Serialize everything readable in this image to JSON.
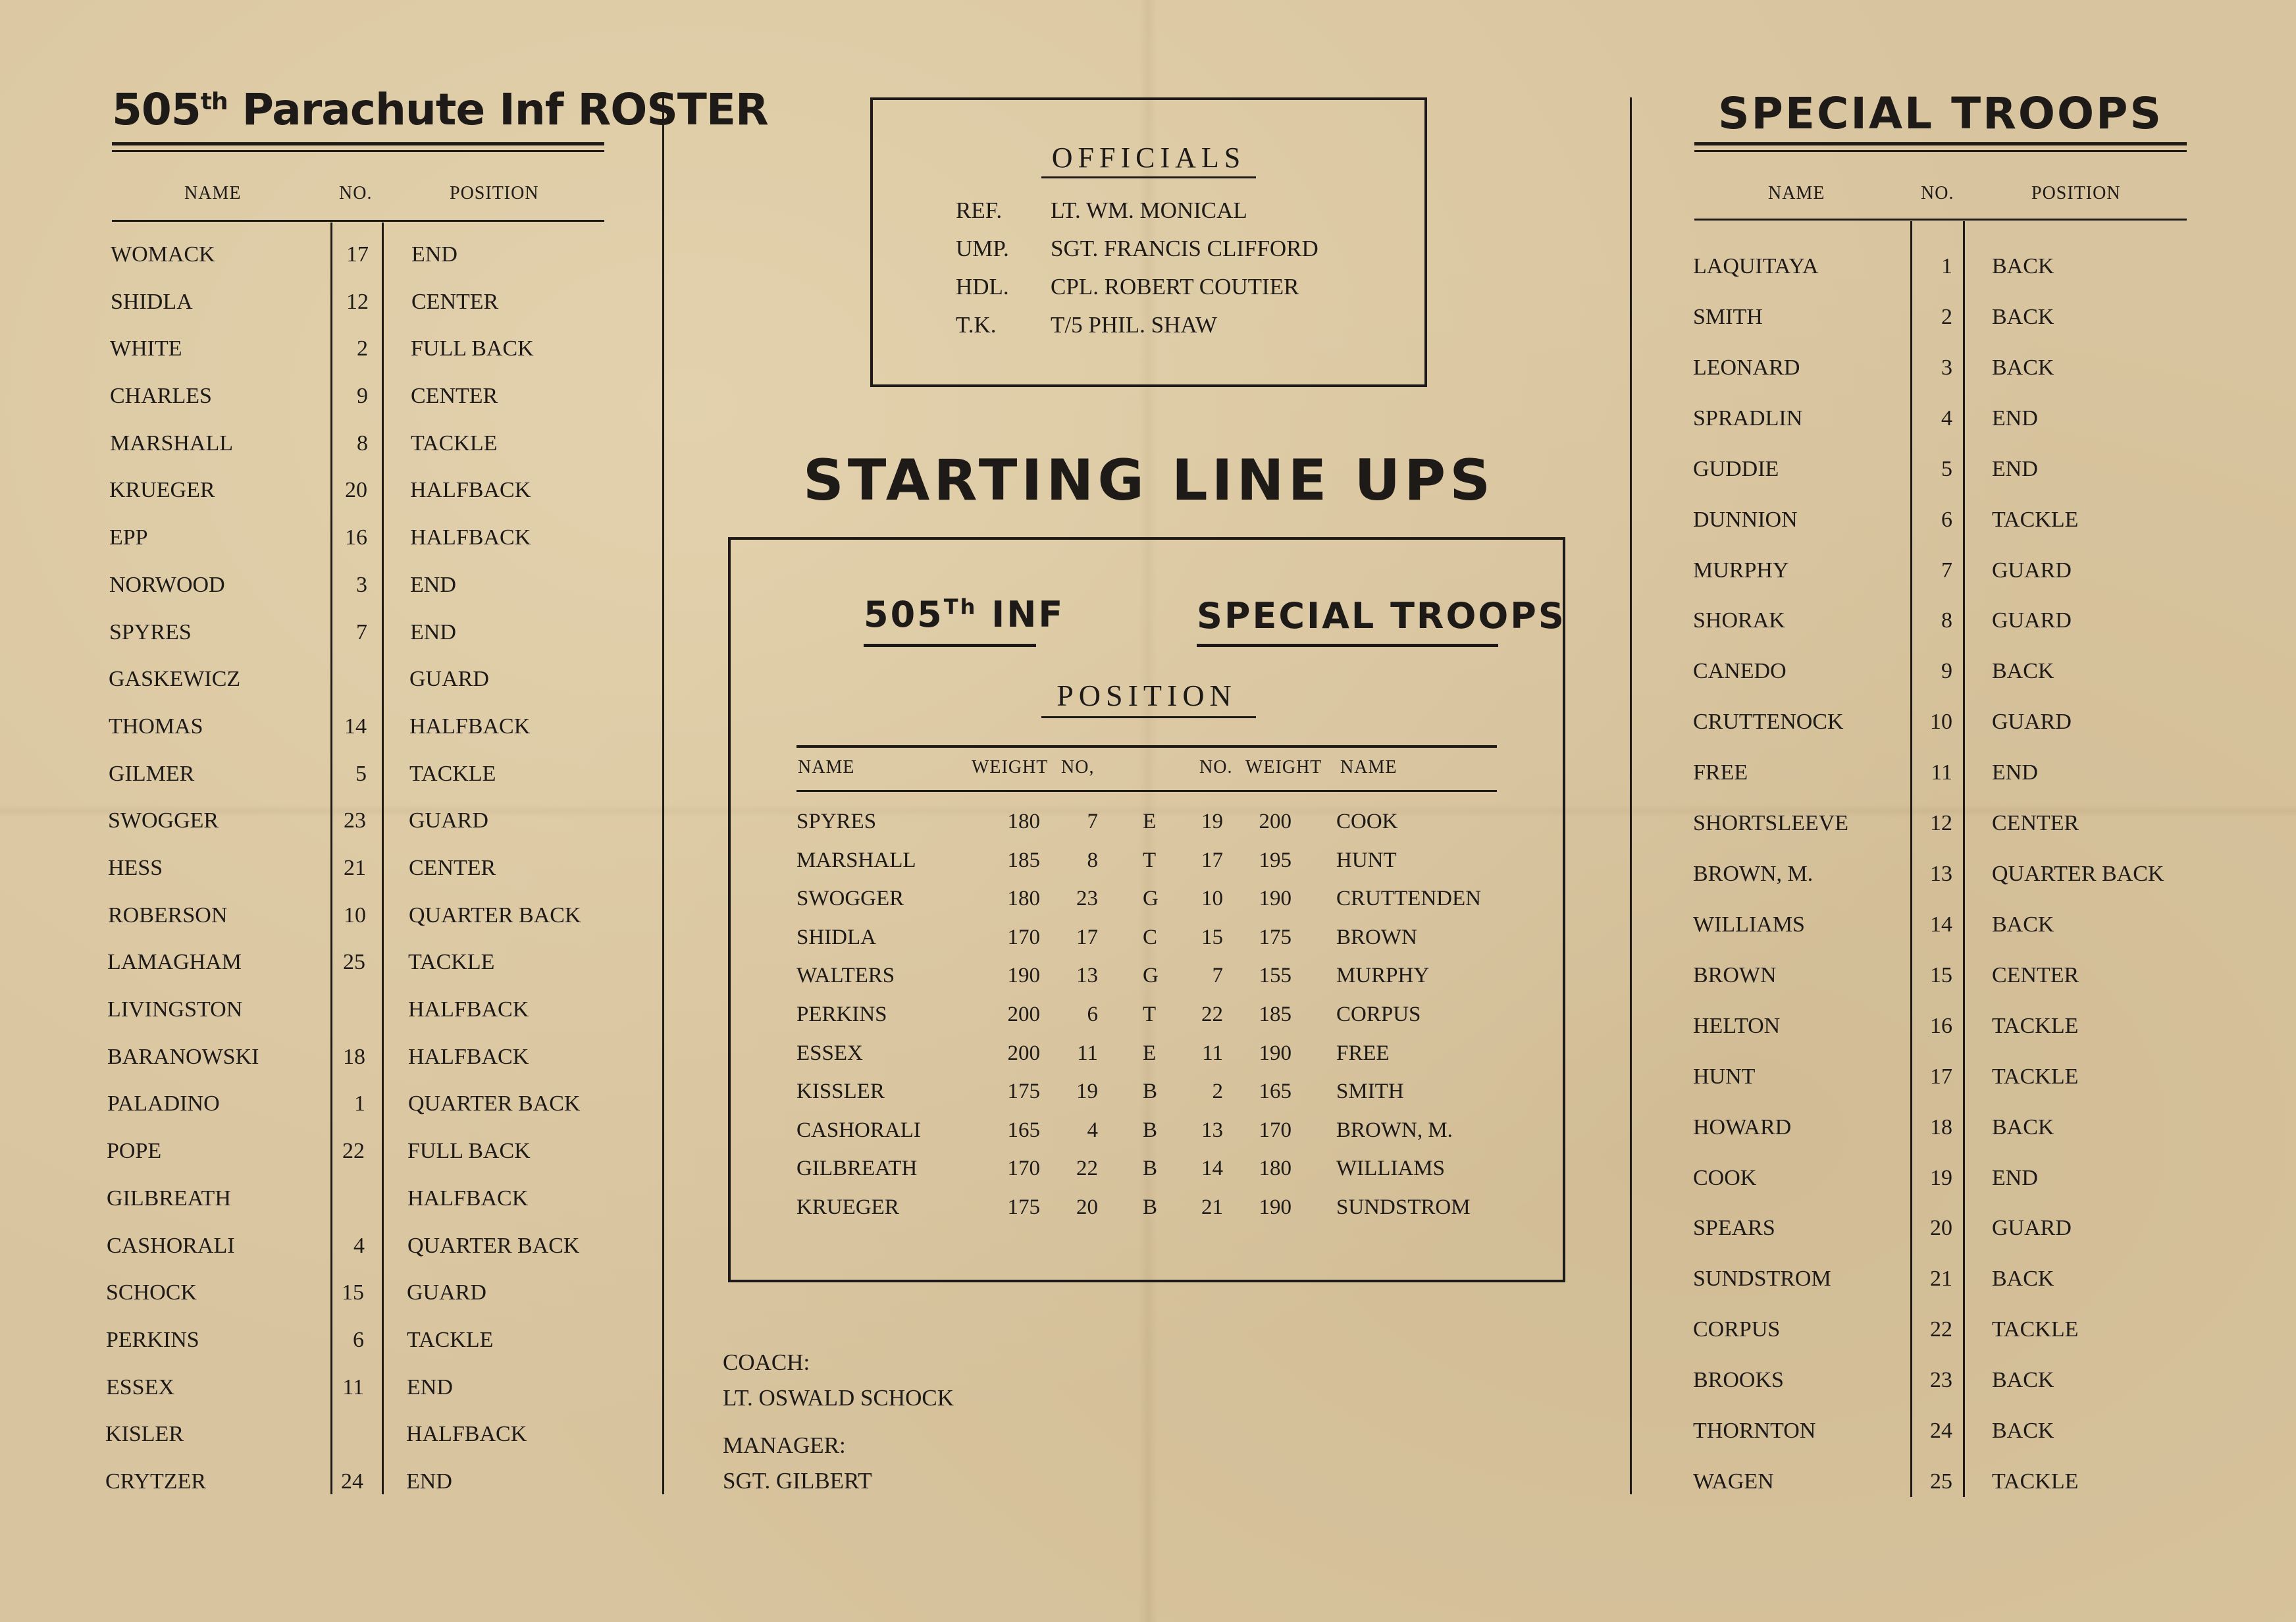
{
  "left_roster": {
    "title_pre": "505",
    "title_sup": "th",
    "title_post": " Parachute Inf ROSTER",
    "headers": [
      "NAME",
      "NO.",
      "POSITION"
    ],
    "rows": [
      {
        "name": "WOMACK",
        "no": "17",
        "pos": "END"
      },
      {
        "name": "SHIDLA",
        "no": "12",
        "pos": "CENTER"
      },
      {
        "name": "WHITE",
        "no": "2",
        "pos": "FULL BACK"
      },
      {
        "name": "CHARLES",
        "no": "9",
        "pos": "CENTER"
      },
      {
        "name": "MARSHALL",
        "no": "8",
        "pos": "TACKLE"
      },
      {
        "name": "KRUEGER",
        "no": "20",
        "pos": "HALFBACK"
      },
      {
        "name": "EPP",
        "no": "16",
        "pos": "HALFBACK"
      },
      {
        "name": "NORWOOD",
        "no": "3",
        "pos": "END"
      },
      {
        "name": "SPYRES",
        "no": "7",
        "pos": "END"
      },
      {
        "name": "GASKEWICZ",
        "no": "",
        "pos": "GUARD"
      },
      {
        "name": "THOMAS",
        "no": "14",
        "pos": "HALFBACK"
      },
      {
        "name": "GILMER",
        "no": "5",
        "pos": "TACKLE"
      },
      {
        "name": "SWOGGER",
        "no": "23",
        "pos": "GUARD"
      },
      {
        "name": "HESS",
        "no": "21",
        "pos": "CENTER"
      },
      {
        "name": "ROBERSON",
        "no": "10",
        "pos": "QUARTER BACK"
      },
      {
        "name": "LAMAGHAM",
        "no": "25",
        "pos": "TACKLE"
      },
      {
        "name": "LIVINGSTON",
        "no": "",
        "pos": "HALFBACK"
      },
      {
        "name": "BARANOWSKI",
        "no": "18",
        "pos": "HALFBACK"
      },
      {
        "name": "PALADINO",
        "no": "1",
        "pos": "QUARTER BACK"
      },
      {
        "name": "POPE",
        "no": "22",
        "pos": "FULL BACK"
      },
      {
        "name": "GILBREATH",
        "no": "",
        "pos": "HALFBACK"
      },
      {
        "name": "CASHORALI",
        "no": "4",
        "pos": "QUARTER BACK"
      },
      {
        "name": "SCHOCK",
        "no": "15",
        "pos": "GUARD"
      },
      {
        "name": "PERKINS",
        "no": "6",
        "pos": "TACKLE"
      },
      {
        "name": "ESSEX",
        "no": "11",
        "pos": "END"
      },
      {
        "name": "KISLER",
        "no": "",
        "pos": "HALFBACK"
      },
      {
        "name": "CRYTZER",
        "no": "24",
        "pos": "END"
      }
    ]
  },
  "officials": {
    "title": "OFFICIALS",
    "rows": [
      {
        "role": "REF.",
        "name": "LT. WM. MONICAL"
      },
      {
        "role": "UMP.",
        "name": "SGT. FRANCIS CLIFFORD"
      },
      {
        "role": "HDL.",
        "name": "CPL. ROBERT COUTIER"
      },
      {
        "role": "T.K.",
        "name": "T/5 PHIL. SHAW"
      }
    ]
  },
  "lineups": {
    "title": "STARTING LINE UPS",
    "team_left_pre": "505",
    "team_left_sup": "Th",
    "team_left_post": " INF",
    "team_right": "SPECIAL TROOPS",
    "position_title": "POSITION",
    "headers": {
      "name_l": "NAME",
      "weight_l": "WEIGHT",
      "no_l": "NO,",
      "no_r": "NO.",
      "weight_r": "WEIGHT",
      "name_r": "NAME"
    },
    "rows": [
      {
        "ln": "SPYRES",
        "lw": "180",
        "lno": "7",
        "pos": "E",
        "rno": "19",
        "rw": "200",
        "rn": "COOK"
      },
      {
        "ln": "MARSHALL",
        "lw": "185",
        "lno": "8",
        "pos": "T",
        "rno": "17",
        "rw": "195",
        "rn": "HUNT"
      },
      {
        "ln": "SWOGGER",
        "lw": "180",
        "lno": "23",
        "pos": "G",
        "rno": "10",
        "rw": "190",
        "rn": "CRUTTENDEN"
      },
      {
        "ln": "SHIDLA",
        "lw": "170",
        "lno": "17",
        "pos": "C",
        "rno": "15",
        "rw": "175",
        "rn": "BROWN"
      },
      {
        "ln": "WALTERS",
        "lw": "190",
        "lno": "13",
        "pos": "G",
        "rno": "7",
        "rw": "155",
        "rn": "MURPHY"
      },
      {
        "ln": "PERKINS",
        "lw": "200",
        "lno": "6",
        "pos": "T",
        "rno": "22",
        "rw": "185",
        "rn": "CORPUS"
      },
      {
        "ln": "ESSEX",
        "lw": "200",
        "lno": "11",
        "pos": "E",
        "rno": "11",
        "rw": "190",
        "rn": "FREE"
      },
      {
        "ln": "KISSLER",
        "lw": "175",
        "lno": "19",
        "pos": "B",
        "rno": "2",
        "rw": "165",
        "rn": "SMITH"
      },
      {
        "ln": "CASHORALI",
        "lw": "165",
        "lno": "4",
        "pos": "B",
        "rno": "13",
        "rw": "170",
        "rn": "BROWN, M."
      },
      {
        "ln": "GILBREATH",
        "lw": "170",
        "lno": "22",
        "pos": "B",
        "rno": "14",
        "rw": "180",
        "rn": "WILLIAMS"
      },
      {
        "ln": "KRUEGER",
        "lw": "175",
        "lno": "20",
        "pos": "B",
        "rno": "21",
        "rw": "190",
        "rn": "SUNDSTROM"
      }
    ]
  },
  "staff": {
    "coach_label": "COACH:",
    "coach_name": "LT. OSWALD SCHOCK",
    "manager_label": "MANAGER:",
    "manager_name": "SGT. GILBERT"
  },
  "right_roster": {
    "title": "SPECIAL TROOPS",
    "headers": [
      "NAME",
      "NO.",
      "POSITION"
    ],
    "rows": [
      {
        "name": "LAQUITAYA",
        "no": "1",
        "pos": "BACK"
      },
      {
        "name": "SMITH",
        "no": "2",
        "pos": "BACK"
      },
      {
        "name": "LEONARD",
        "no": "3",
        "pos": "BACK"
      },
      {
        "name": "SPRADLIN",
        "no": "4",
        "pos": "END"
      },
      {
        "name": "GUDDIE",
        "no": "5",
        "pos": "END"
      },
      {
        "name": "DUNNION",
        "no": "6",
        "pos": "TACKLE"
      },
      {
        "name": "MURPHY",
        "no": "7",
        "pos": "GUARD"
      },
      {
        "name": "SHORAK",
        "no": "8",
        "pos": "GUARD"
      },
      {
        "name": "CANEDO",
        "no": "9",
        "pos": "BACK"
      },
      {
        "name": "CRUTTENOCK",
        "no": "10",
        "pos": "GUARD"
      },
      {
        "name": "FREE",
        "no": "11",
        "pos": "END"
      },
      {
        "name": "SHORTSLEEVE",
        "no": "12",
        "pos": "CENTER"
      },
      {
        "name": "BROWN, M.",
        "no": "13",
        "pos": "QUARTER BACK"
      },
      {
        "name": "WILLIAMS",
        "no": "14",
        "pos": "BACK"
      },
      {
        "name": "BROWN",
        "no": "15",
        "pos": "CENTER"
      },
      {
        "name": "HELTON",
        "no": "16",
        "pos": "TACKLE"
      },
      {
        "name": "HUNT",
        "no": "17",
        "pos": "TACKLE"
      },
      {
        "name": "HOWARD",
        "no": "18",
        "pos": "BACK"
      },
      {
        "name": "COOK",
        "no": "19",
        "pos": "END"
      },
      {
        "name": "SPEARS",
        "no": "20",
        "pos": "GUARD"
      },
      {
        "name": "SUNDSTROM",
        "no": "21",
        "pos": "BACK"
      },
      {
        "name": "CORPUS",
        "no": "22",
        "pos": "TACKLE"
      },
      {
        "name": "BROOKS",
        "no": "23",
        "pos": "BACK"
      },
      {
        "name": "THORNTON",
        "no": "24",
        "pos": "BACK"
      },
      {
        "name": "WAGEN",
        "no": "25",
        "pos": "TACKLE"
      }
    ]
  }
}
